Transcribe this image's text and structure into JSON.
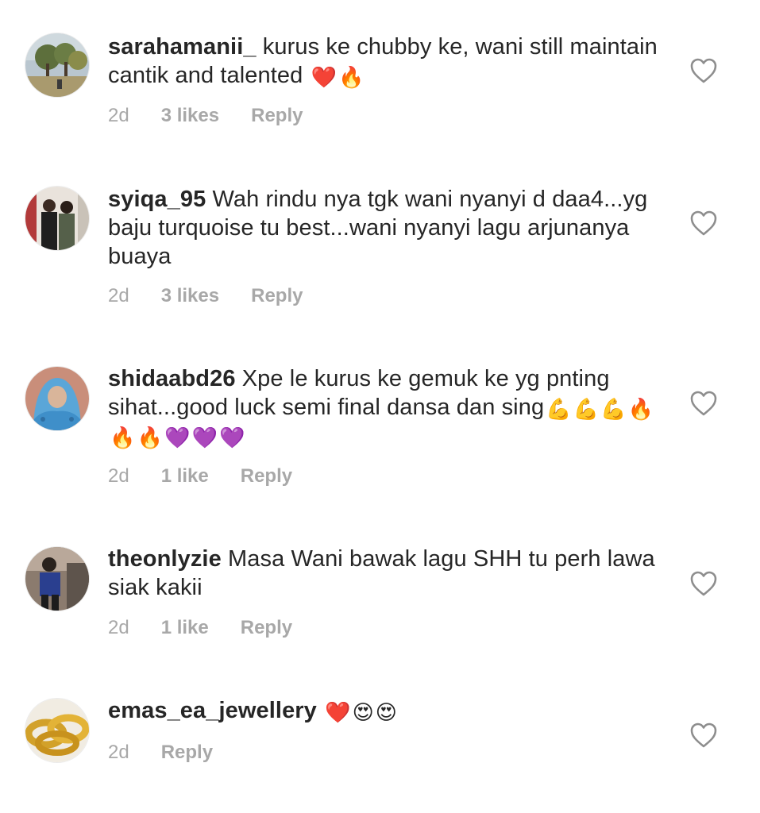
{
  "comments": [
    {
      "username": "sarahamanii_",
      "text": "kurus ke chubby ke, wani still maintain cantik and talented",
      "emojis": [
        "❤️",
        "🔥"
      ],
      "time": "2d",
      "likes": "3 likes",
      "reply": "Reply"
    },
    {
      "username": "syiqa_95",
      "text": "Wah rindu nya tgk wani nyanyi d daa4...yg baju turquoise tu best...wani nyanyi lagu arjunanya buaya",
      "emojis": [],
      "time": "2d",
      "likes": "3 likes",
      "reply": "Reply"
    },
    {
      "username": "shidaabd26",
      "text": "Xpe le kurus ke gemuk ke yg pnting sihat...good luck semi final dansa dan sing",
      "emojis": [
        "💪",
        "💪",
        "💪",
        "🔥",
        "🔥",
        "🔥",
        "💜",
        "💜",
        "💜"
      ],
      "time": "2d",
      "likes": "1 like",
      "reply": "Reply"
    },
    {
      "username": "theonlyzie",
      "text": "Masa Wani bawak lagu SHH tu perh lawa siak kakii",
      "emojis": [],
      "time": "2d",
      "likes": "1 like",
      "reply": "Reply"
    },
    {
      "username": "emas_ea_jewellery",
      "text": "",
      "emojis": [
        "❤️",
        "😍",
        "😍"
      ],
      "time": "2d",
      "likes": "",
      "reply": "Reply"
    }
  ],
  "icons": {
    "like": "heart-outline-icon"
  },
  "colors": {
    "text": "#262626",
    "meta": "#a8a8a8",
    "icon_stroke": "#8e8e8e"
  }
}
